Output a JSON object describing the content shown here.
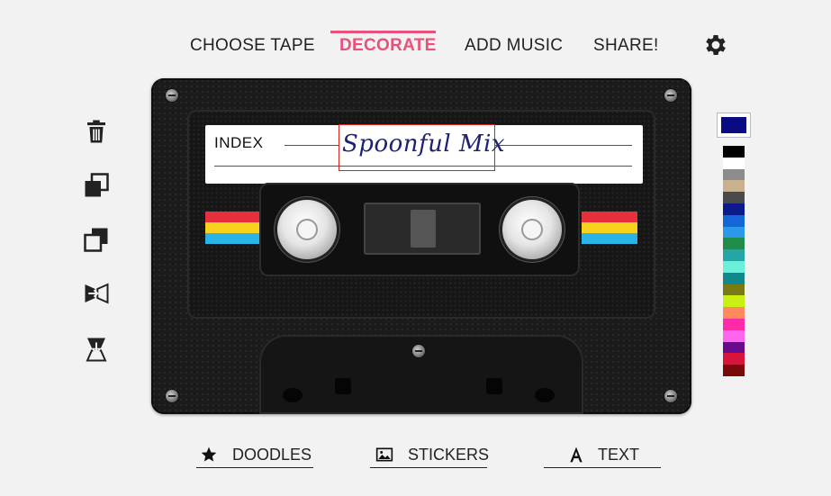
{
  "nav": {
    "items": [
      {
        "label": "CHOOSE TAPE",
        "active": false
      },
      {
        "label": "DECORATE",
        "active": true
      },
      {
        "label": "ADD MUSIC",
        "active": false
      },
      {
        "label": "SHARE!",
        "active": false
      }
    ],
    "settings_icon": "gear-icon",
    "accent_color": "#e8517a"
  },
  "tools": [
    {
      "name": "trash-icon"
    },
    {
      "name": "bring-forward-icon"
    },
    {
      "name": "send-backward-icon"
    },
    {
      "name": "flip-horizontal-icon"
    },
    {
      "name": "flip-vertical-icon"
    }
  ],
  "cassette": {
    "index_label": "INDEX",
    "title": "Spoonful Mix",
    "title_color": "#1e2277",
    "stripe_colors": [
      "#e8303c",
      "#f7d31e",
      "#2ab3e6"
    ]
  },
  "palette": {
    "selected": "#0a0a82",
    "colors": [
      "#000000",
      "#ffffff",
      "#8c8c8c",
      "#c9b08e",
      "#4a4a4a",
      "#0c1a8c",
      "#1466d6",
      "#2b98ea",
      "#1f8c4b",
      "#25a6a6",
      "#6af0d8",
      "#0f8a8a",
      "#7a7a14",
      "#c8f014",
      "#ff8a5c",
      "#ff2aa8",
      "#ff66ee",
      "#6a0a8c",
      "#d6143c",
      "#7a0a0a"
    ]
  },
  "bottom_tabs": [
    {
      "label": "DOODLES",
      "icon": "star-icon"
    },
    {
      "label": "STICKERS",
      "icon": "image-icon"
    },
    {
      "label": "TEXT",
      "icon": "text-icon"
    }
  ]
}
